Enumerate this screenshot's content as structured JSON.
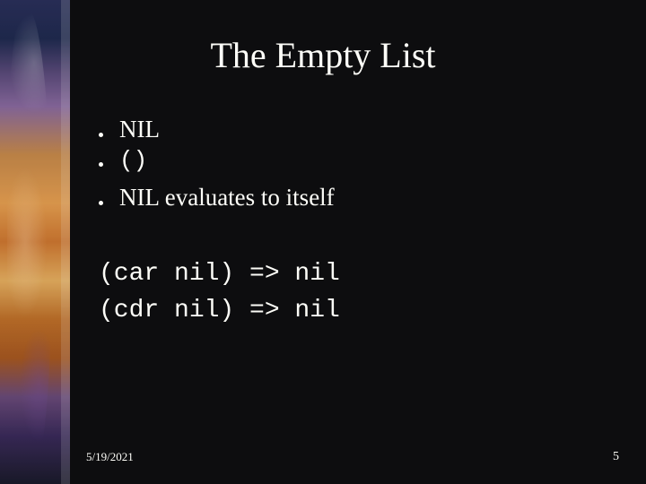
{
  "title": "The Empty List",
  "bullets": [
    {
      "text": "NIL",
      "mono": false
    },
    {
      "text": "()",
      "mono": true
    },
    {
      "text": "NIL evaluates to itself",
      "mono": false
    }
  ],
  "code_lines": [
    "(car nil) => nil",
    "(cdr nil) => nil"
  ],
  "footer": {
    "date": "5/19/2021",
    "page": "5"
  }
}
